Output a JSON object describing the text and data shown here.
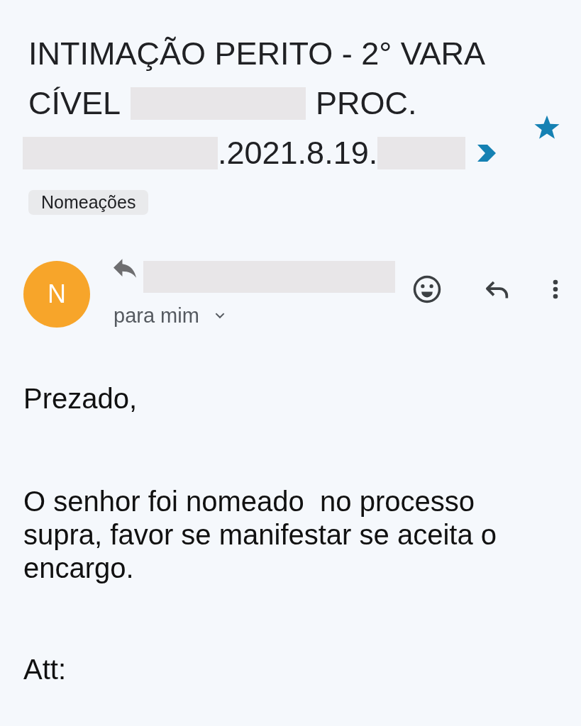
{
  "email": {
    "subject": [
      {
        "kind": "text",
        "text": "INTIMAÇÃO PERITO - 2° VARA"
      },
      {
        "kind": "text",
        "text": "CÍVEL"
      },
      {
        "kind": "redacted"
      },
      {
        "kind": "text",
        "text": "PROC."
      },
      {
        "kind": "redacted"
      },
      {
        "kind": "text",
        "text": ".2021.8.19."
      },
      {
        "kind": "redacted"
      }
    ],
    "important": true,
    "starred": true,
    "labels": [
      "Nomeações"
    ],
    "sender": {
      "initial": "N",
      "replied": true,
      "name_hidden": true
    },
    "recipient": "para mim",
    "body": [
      "Prezado,",
      "O senhor foi nomeado  no processo supra, favor se manifestar se aceita o encargo.",
      "Att:"
    ]
  }
}
